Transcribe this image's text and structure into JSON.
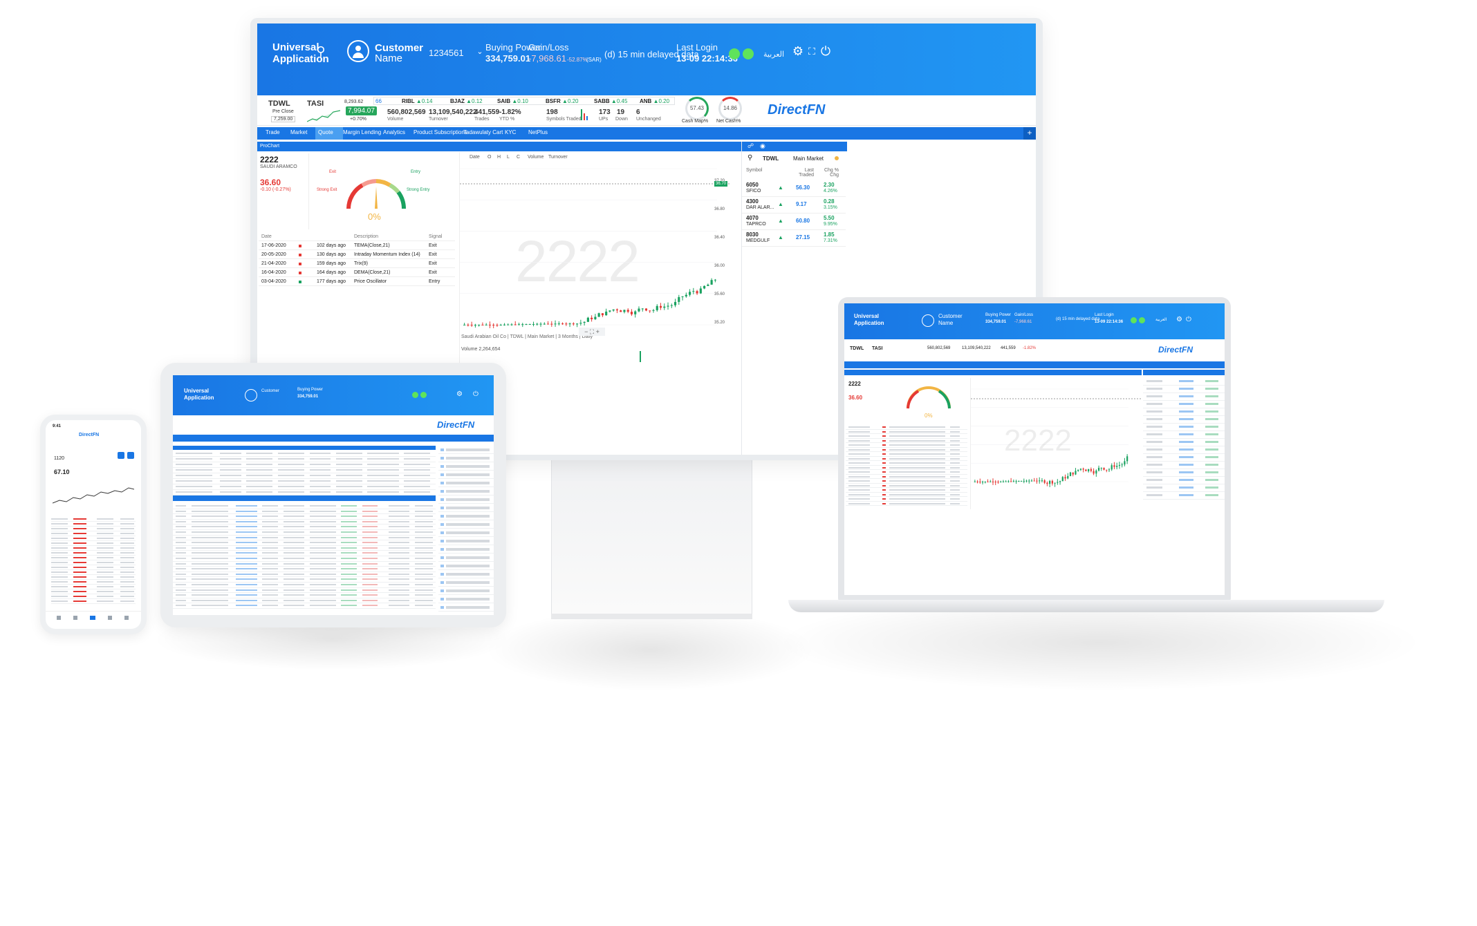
{
  "header": {
    "app_title_1": "Universal",
    "app_title_2": "Application",
    "customer_label": "Customer",
    "customer_name": "Name",
    "account": "1234561",
    "buying_power_label": "Buying Power",
    "buying_power_value": "334,759.01",
    "gain_loss_label": "Gain/Loss",
    "gain_loss_value": "-7,968.61",
    "gain_loss_pct": "-52.87%",
    "gain_loss_ccy": "(SAR)",
    "delay_text": "(d) 15 min delayed data",
    "last_login_label": "Last Login",
    "last_login_value": "13-09 22:14:36",
    "language": "العربية"
  },
  "market": {
    "tdwl": "TDWL",
    "pre_close_label": "Pre Close",
    "pre_close_value": "7,259.00",
    "tasi": "TASI",
    "tasi_change": "8,293.62",
    "tasi_value": "7,994.07",
    "tasi_pct": "+0.70%",
    "ticker": [
      {
        "sym": "RIBL",
        "chg": "0.14"
      },
      {
        "sym": "BJAZ",
        "chg": "0.12"
      },
      {
        "sym": "SAIB",
        "chg": "0.10"
      },
      {
        "sym": "BSFR",
        "chg": "0.20"
      },
      {
        "sym": "SABB",
        "chg": "0.45"
      },
      {
        "sym": "ANB",
        "chg": "0.20"
      }
    ],
    "ticker_lead": "66",
    "volume": "560,802,569",
    "volume_label": "Volume",
    "turnover": "13,109,540,222",
    "turnover_label": "Turnover",
    "trades": "441,559",
    "trades_label": "Trades",
    "ytd": "-1.82%",
    "ytd_label": "YTD %",
    "symbols_traded": "198",
    "symbols_traded_label": "Symbols Traded",
    "ups": "173",
    "ups_label": "UPs",
    "down": "19",
    "down_label": "Down",
    "unchanged": "6",
    "unchanged_label": "Unchanged",
    "cash_map_value": "57.43",
    "cash_map_label": "Cash Map%",
    "net_cash_value": "14.86",
    "net_cash_label": "Net Cash%",
    "logo": "DirectFN"
  },
  "menu": [
    "Trade",
    "Market",
    "Quote",
    "Margin Lending",
    "Analytics",
    "Product Subscriptions",
    "Tadawulaty Cart",
    "KYC",
    "NetPlus"
  ],
  "prochart": {
    "panel_title": "ProChart",
    "symbol": "2222",
    "name": "SAUDI ARAMCO",
    "price": "36.60",
    "change": "-0.10",
    "change_pct": "(-0.27%)",
    "gauge_exit": "Exit",
    "gauge_entry": "Entry",
    "gauge_strong_exit": "Strong Exit",
    "gauge_strong_entry": "Strong Entry",
    "gauge_value": "0%",
    "signals_header": {
      "date": "Date",
      "desc": "Description",
      "signal": "Signal"
    },
    "signals": [
      {
        "date": "17-06-2020",
        "ago": "102 days ago",
        "desc": "TEMA(Close,21)",
        "signal": "Exit",
        "color": "#e53935"
      },
      {
        "date": "20-05-2020",
        "ago": "130 days ago",
        "desc": "Intraday Momentum Index (14)",
        "signal": "Exit",
        "color": "#e53935"
      },
      {
        "date": "21-04-2020",
        "ago": "159 days ago",
        "desc": "Trix(9)",
        "signal": "Exit",
        "color": "#e53935"
      },
      {
        "date": "16-04-2020",
        "ago": "164 days ago",
        "desc": "DEMA(Close,21)",
        "signal": "Exit",
        "color": "#e53935"
      },
      {
        "date": "03-04-2020",
        "ago": "177 days ago",
        "desc": "Price Oscillator",
        "signal": "Entry",
        "color": "#1aa260"
      }
    ],
    "chart_toolbar": [
      "Date",
      "O",
      "H",
      "L",
      "C",
      "Volume",
      "Turnover"
    ],
    "chart_watermark": "2222",
    "chart_caption": "Saudi Arabian Oil Co | TDWL | Main Market | 3 Months | Daily",
    "volume_label": "Volume",
    "volume_value": "2,264,654",
    "y_ticks": [
      "37.20",
      "36.80",
      "36.40",
      "36.00",
      "35.60",
      "35.20"
    ],
    "last_price_tag": "36.70"
  },
  "watchlist": {
    "exchange": "TDWL",
    "market": "Main Market",
    "col_symbol": "Symbol",
    "col_last": "Last Traded",
    "col_chg": "Chg % Chg",
    "rows": [
      {
        "sym": "6050",
        "name": "SFICO",
        "last": "56.30",
        "chg": "2.30",
        "pct": "4.26%"
      },
      {
        "sym": "4300",
        "name": "DAR ALAR...",
        "last": "9.17",
        "chg": "0.28",
        "pct": "3.15%"
      },
      {
        "sym": "4070",
        "name": "TAPRCO",
        "last": "60.80",
        "chg": "5.50",
        "pct": "9.95%"
      },
      {
        "sym": "8030",
        "name": "MEDGULF",
        "last": "27.15",
        "chg": "1.85",
        "pct": "7.31%"
      }
    ]
  },
  "tablet": {
    "logo": "DirectFN"
  },
  "phone": {
    "logo": "DirectFN",
    "time": "9:41",
    "symbol": "1120",
    "price": "67.10"
  }
}
